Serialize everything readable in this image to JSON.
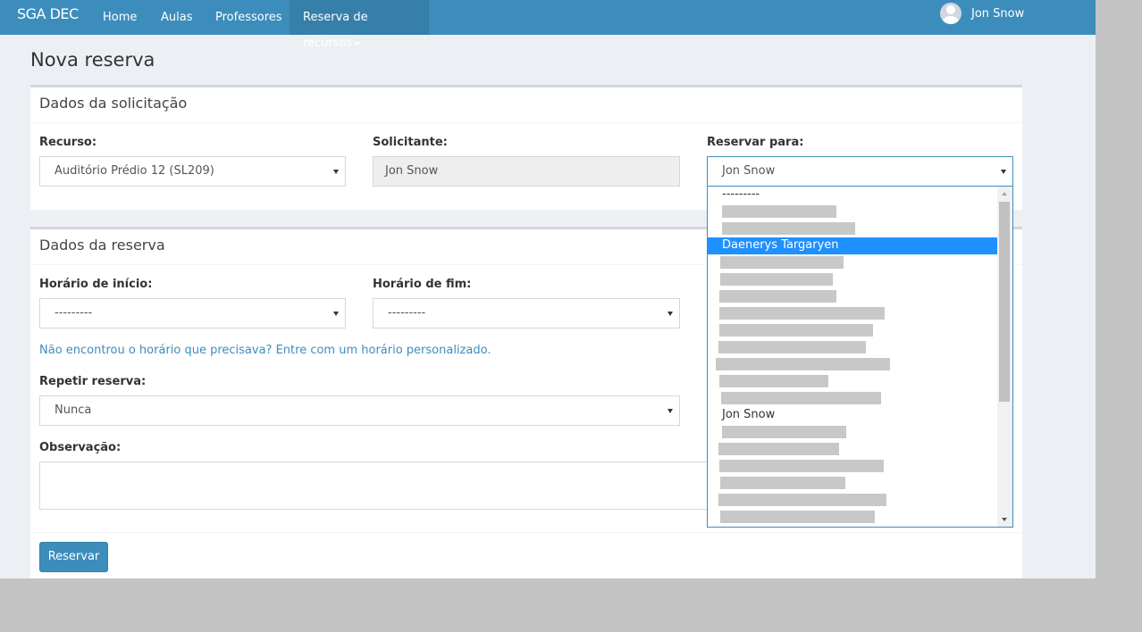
{
  "navbar": {
    "brand": "SGA DEC",
    "items": [
      {
        "label": "Home"
      },
      {
        "label": "Aulas"
      },
      {
        "label": "Professores"
      },
      {
        "label": "Reserva de recursos"
      }
    ],
    "user_name": "Jon Snow"
  },
  "page_title": "Nova reserva",
  "solicitacao": {
    "header": "Dados da solicitação",
    "recurso_label": "Recurso:",
    "recurso_value": "Auditório Prédio 12 (SL209)",
    "solicitante_label": "Solicitante:",
    "solicitante_value": "Jon Snow",
    "reservar_para_label": "Reservar para:",
    "reservar_para_value": "Jon Snow"
  },
  "reserva": {
    "header": "Dados da reserva",
    "inicio_label": "Horário de início:",
    "inicio_value": "---------",
    "fim_label": "Horário de fim:",
    "fim_value": "---------",
    "custom_link": "Não encontrou o horário que precisava? Entre com um horário personalizado.",
    "repetir_label": "Repetir reserva:",
    "repetir_value": "Nunca",
    "observacao_label": "Observação:",
    "submit_label": "Reservar"
  },
  "dropdown": {
    "options": [
      {
        "text": "---------"
      },
      {
        "text": "",
        "redacted": true
      },
      {
        "text": "",
        "redacted": true
      },
      {
        "text": "Daenerys Targaryen",
        "selected": true
      },
      {
        "text": "",
        "redacted": true
      },
      {
        "text": "",
        "redacted": true
      },
      {
        "text": "",
        "redacted": true
      },
      {
        "text": "",
        "redacted": true
      },
      {
        "text": "",
        "redacted": true
      },
      {
        "text": "",
        "redacted": true
      },
      {
        "text": "",
        "redacted": true
      },
      {
        "text": "",
        "redacted": true
      },
      {
        "text": "",
        "redacted": true
      },
      {
        "text": "Jon Snow"
      },
      {
        "text": "",
        "redacted": true
      },
      {
        "text": "",
        "redacted": true
      },
      {
        "text": "",
        "redacted": true
      },
      {
        "text": "",
        "redacted": true
      },
      {
        "text": "",
        "redacted": true
      },
      {
        "text": "",
        "redacted": true
      }
    ]
  }
}
